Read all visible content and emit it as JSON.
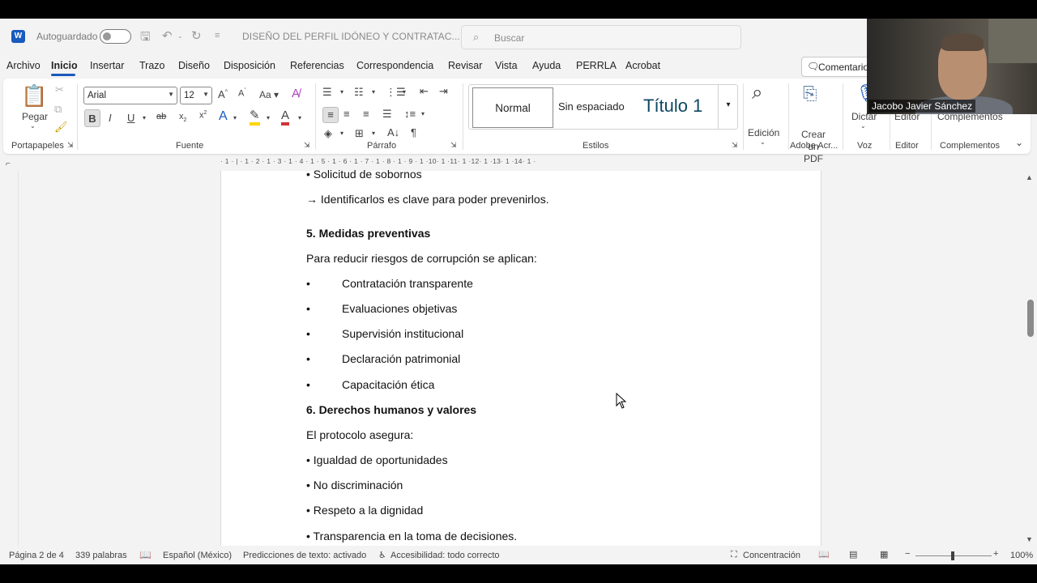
{
  "titlebar": {
    "autosave_label": "Autoguardado",
    "document_title": "DISEÑO DEL PERFIL IDÓNEO Y CONTRATAC...",
    "search_placeholder": "Buscar",
    "app_icon": "word-icon"
  },
  "menu": {
    "items": [
      "Archivo",
      "Inicio",
      "Insertar",
      "Trazo",
      "Diseño",
      "Disposición",
      "Referencias",
      "Correspondencia",
      "Revisar",
      "Vista",
      "Ayuda",
      "PERRLA",
      "Acrobat"
    ],
    "active": "Inicio",
    "comments_label": "Comentarios"
  },
  "ribbon": {
    "clipboard": {
      "paste_label": "Pegar",
      "group_label": "Portapapeles"
    },
    "font": {
      "font_name": "Arial",
      "font_size": "12",
      "group_label": "Fuente",
      "case_label": "Aa"
    },
    "paragraph": {
      "group_label": "Párrafo"
    },
    "styles": {
      "items": [
        "Normal",
        "Sin espaciado",
        "Título 1"
      ],
      "group_label": "Estilos"
    },
    "editing": {
      "label": "Edición"
    },
    "adobe": {
      "create_pdf": "Crear un PDF",
      "group_label": "Adobe Acr..."
    },
    "voice": {
      "dictate": "Dictar",
      "group_label": "Voz"
    },
    "editor": {
      "label": "Editor",
      "group_label": "Editor"
    },
    "addins": {
      "label": "Complementos",
      "group_label": "Complementos"
    }
  },
  "ruler": {
    "text": "· 1 · | · 1 · 2 · 1 · 3 · 1 · 4 · 1 · 5 · 1 · 6 · 1 · 7 · 1 · 8 · 1 · 9 · 1 ·10· 1 ·11· 1 ·12· 1 ·13· 1 ·14· 1 ·"
  },
  "document": {
    "partial_top": "• Solicitud de sobornos",
    "arrow_line": "→ Identificarlos es clave para poder prevenirlos.",
    "section5_heading": "5. Medidas preventivas",
    "section5_intro": "Para reducir riesgos de corrupción se aplican:",
    "bullet_glyph": "•",
    "section5_bullets": [
      "Contratación transparente",
      "Evaluaciones objetivas",
      "Supervisión institucional",
      "Declaración patrimonial",
      "Capacitación ética"
    ],
    "section6_heading": "6. Derechos humanos y valores",
    "section6_intro": "El protocolo asegura:",
    "section6_items": [
      "• Igualdad de oportunidades",
      "• No discriminación",
      "• Respeto a la dignidad",
      "• Transparencia en la toma de decisiones."
    ]
  },
  "status": {
    "page": "Página 2 de 4",
    "words": "339 palabras",
    "language": "Español (México)",
    "predictions": "Predicciones de texto: activado",
    "accessibility": "Accesibilidad: todo correcto",
    "focus": "Concentración",
    "zoom": "100%"
  },
  "webcam": {
    "participant_name": "Jacobo Javier Sánchez"
  },
  "colors": {
    "accent": "#185abd",
    "title_style": "#0f4761",
    "highlight": "#ffd400",
    "font_color": "#d13438"
  }
}
